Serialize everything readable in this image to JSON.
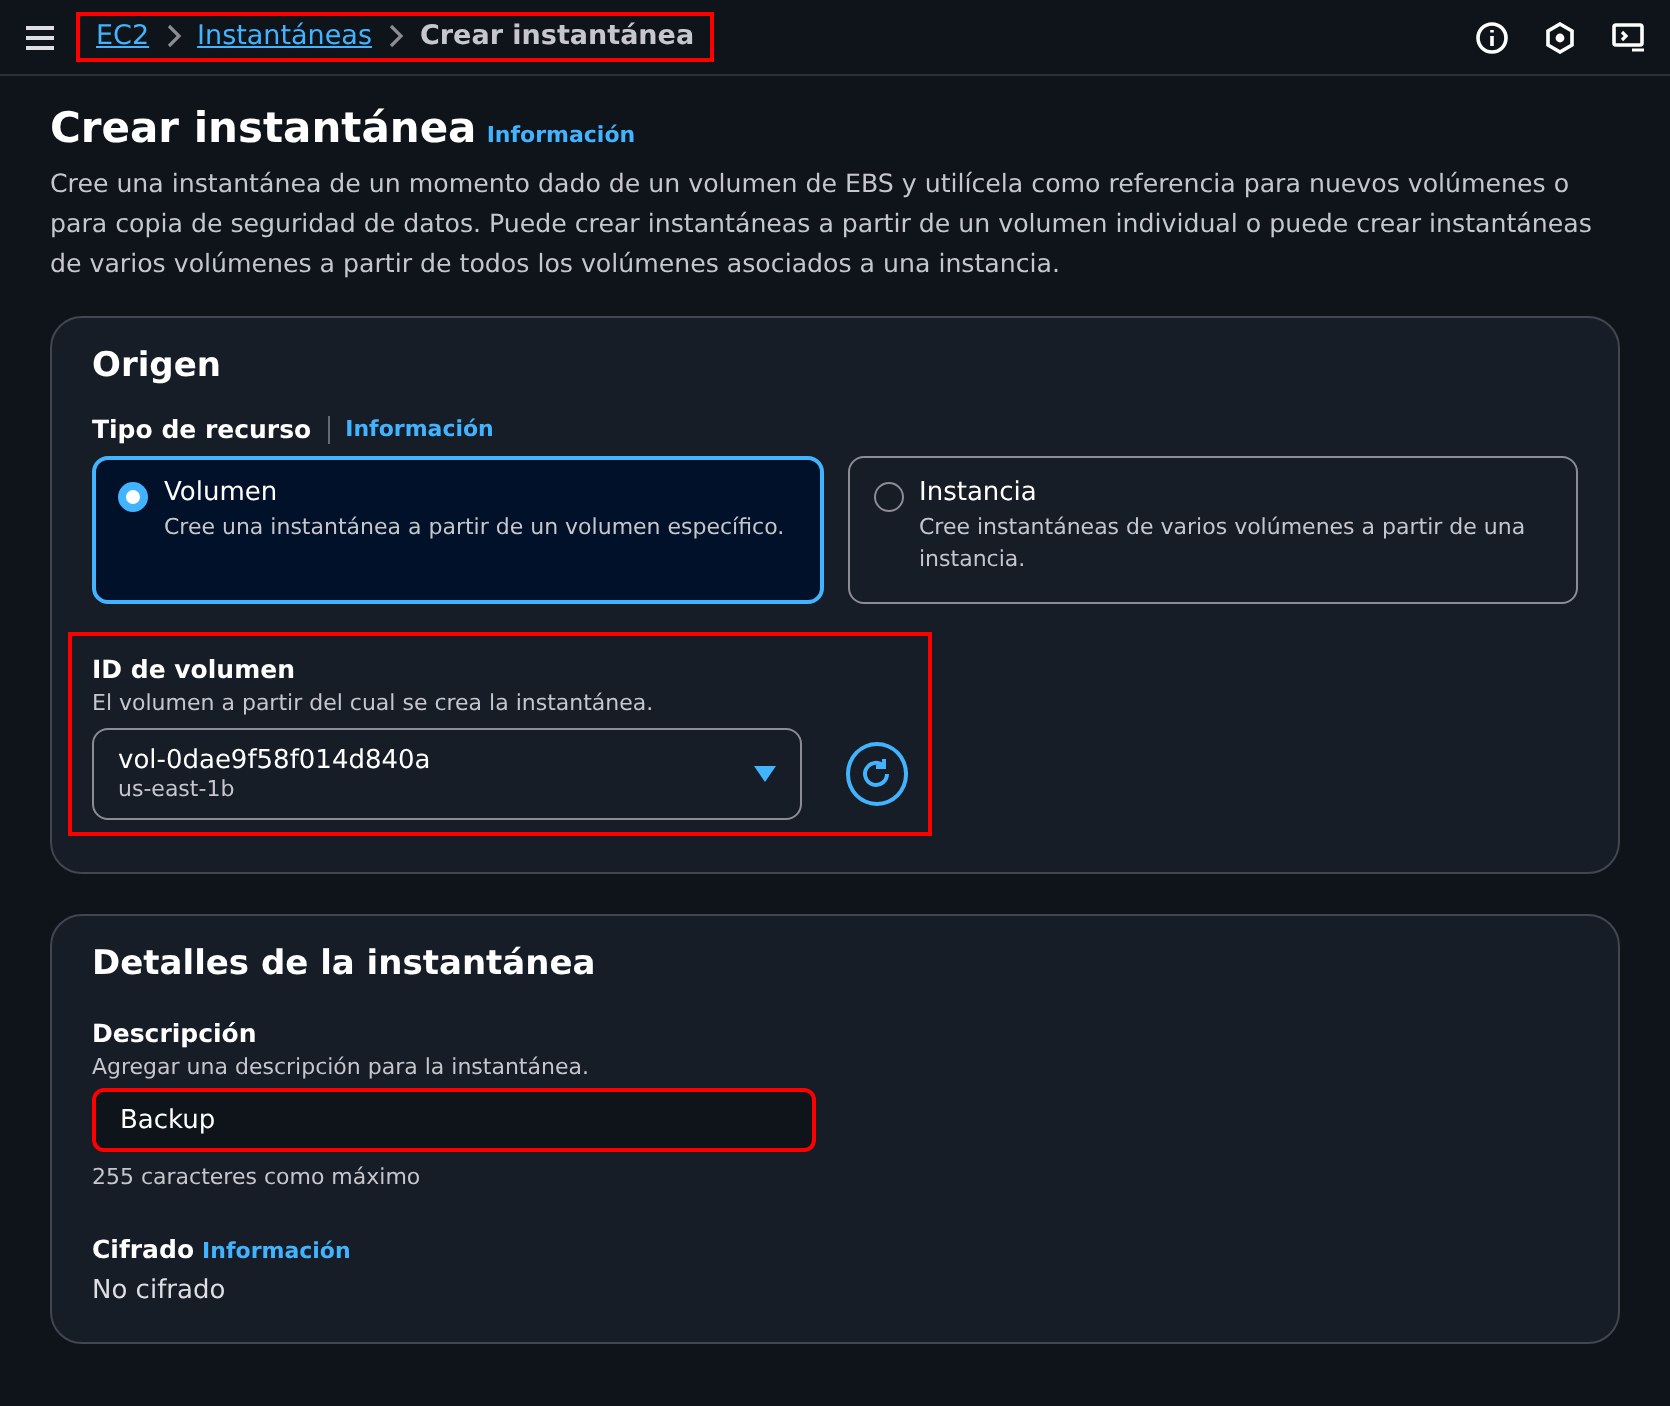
{
  "breadcrumbs": {
    "highlighted": true,
    "items": [
      {
        "label": "EC2",
        "kind": "link"
      },
      {
        "label": "Instantáneas",
        "kind": "link"
      },
      {
        "label": "Crear instantánea",
        "kind": "current"
      }
    ]
  },
  "page": {
    "title": "Crear instantánea",
    "info": "Información",
    "description": "Cree una instantánea de un momento dado de un volumen de EBS y utilícela como referencia para nuevos volúmenes o para copia de seguridad de datos. Puede crear instantáneas a partir de un volumen individual o puede crear instantáneas de varios volúmenes a partir de todos los volúmenes asociados a una instancia."
  },
  "origin": {
    "title": "Origen",
    "resource_type": {
      "label": "Tipo de recurso",
      "info": "Información",
      "options": [
        {
          "label": "Volumen",
          "description": "Cree una instantánea a partir de un volumen específico.",
          "selected": true
        },
        {
          "label": "Instancia",
          "description": "Cree instantáneas de varios volúmenes a partir de una instancia.",
          "selected": false
        }
      ]
    },
    "volume": {
      "highlighted": true,
      "label": "ID de volumen",
      "hint": "El volumen a partir del cual se crea la instantánea.",
      "value": "vol-0dae9f58f014d840a",
      "sub": "us-east-1b"
    }
  },
  "details": {
    "title": "Detalles de la instantánea",
    "description": {
      "highlighted": true,
      "label": "Descripción",
      "hint": "Agregar una descripción para la instantánea.",
      "value": "Backup",
      "constraint": "255 caracteres como máximo"
    },
    "encryption": {
      "label": "Cifrado",
      "info": "Información",
      "value": "No cifrado"
    }
  }
}
